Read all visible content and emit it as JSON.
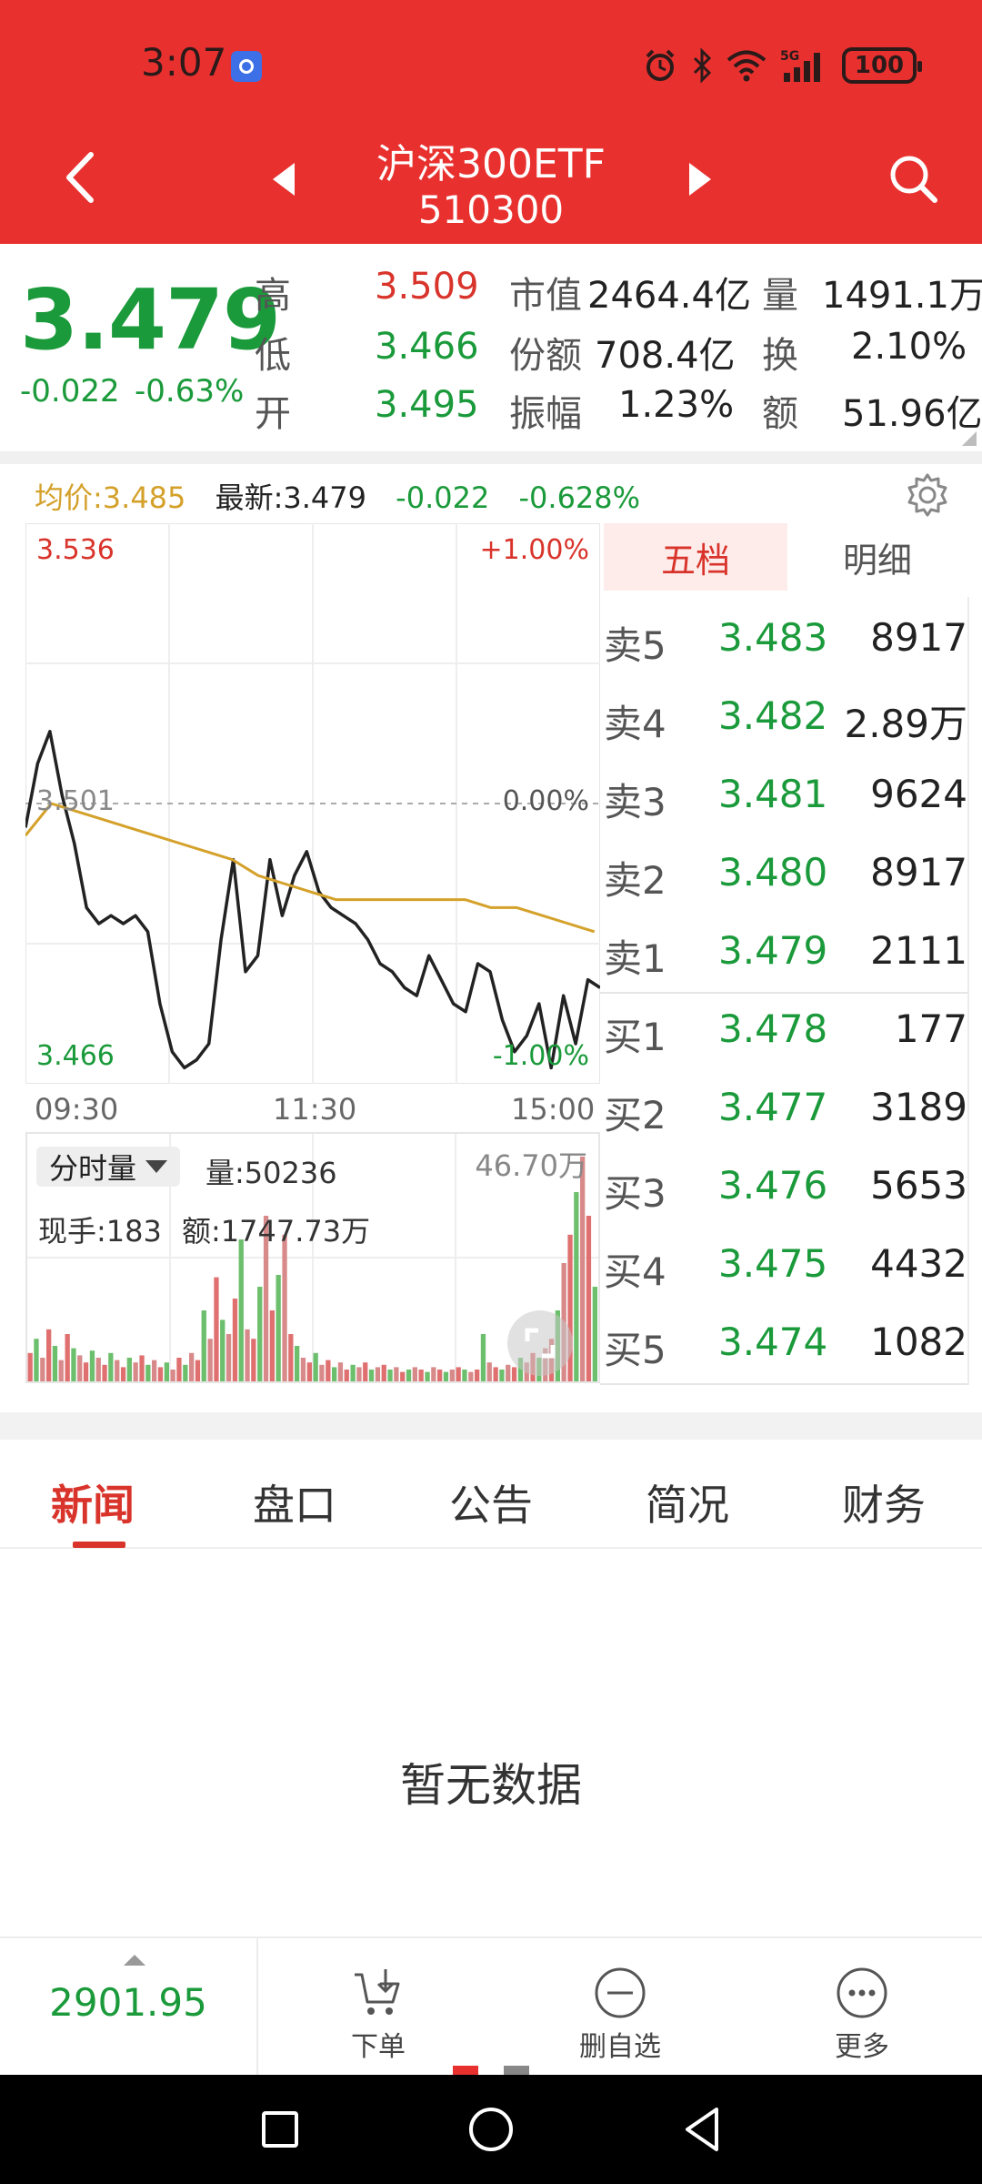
{
  "status_bar": {
    "time": "3:07",
    "battery": "100",
    "icons": [
      "alarm-icon",
      "bluetooth-icon",
      "wifi-icon",
      "signal-5g-icon",
      "battery-icon"
    ]
  },
  "header": {
    "title": "沪深300ETF",
    "code": "510300",
    "background": "#e8312f"
  },
  "quote": {
    "last_price": "3.479",
    "change": "-0.022",
    "change_pct": "-0.63%",
    "high_label": "高",
    "high": "3.509",
    "low_label": "低",
    "low": "3.466",
    "open_label": "开",
    "open": "3.495",
    "mktcap_label": "市值",
    "mktcap": "2464.4亿",
    "shares_label": "份额",
    "shares": "708.4亿",
    "amplitude_label": "振幅",
    "amplitude": "1.23%",
    "volume_label": "量",
    "volume": "1491.1万",
    "turnover_label": "换",
    "turnover": "2.10%",
    "amount_label": "额",
    "amount": "51.96亿"
  },
  "info_line": {
    "avg": "均价:3.485",
    "latest": "最新:3.479",
    "chg": "-0.022",
    "chg_pct": "-0.628%"
  },
  "chart": {
    "top_price": "3.536",
    "top_pct": "+1.00%",
    "mid_price": "3.501",
    "mid_pct": "0.00%",
    "bottom_price": "3.466",
    "bottom_pct": "-1.00%",
    "time_ticks": [
      "09:30",
      "11:30",
      "15:00"
    ]
  },
  "chart_data": {
    "type": "line",
    "title": "",
    "xlabel": "",
    "ylabel": "",
    "x": [
      "09:30",
      "11:30",
      "15:00"
    ],
    "ylim": [
      3.466,
      3.536
    ],
    "reference": 3.501,
    "series": [
      {
        "name": "",
        "color": "#222222",
        "values": [
          3.498,
          3.506,
          3.51,
          3.502,
          3.496,
          3.488,
          3.486,
          3.487,
          3.486,
          3.487,
          3.485,
          3.476,
          3.47,
          3.468,
          3.469,
          3.471,
          3.484,
          3.494,
          3.48,
          3.482,
          3.494,
          3.487,
          3.492,
          3.495,
          3.49,
          3.488,
          3.487,
          3.486,
          3.484,
          3.481,
          3.48,
          3.478,
          3.477,
          3.482,
          3.479,
          3.476,
          3.475,
          3.481,
          3.48,
          3.474,
          3.47,
          3.472,
          3.476,
          3.468,
          3.477,
          3.471,
          3.479,
          3.478
        ]
      },
      {
        "name": "",
        "color": "#d4a12a",
        "values": [
          3.497,
          3.501,
          3.5,
          3.499,
          3.498,
          3.497,
          3.496,
          3.495,
          3.494,
          3.492,
          3.491,
          3.49,
          3.489,
          3.489,
          3.489,
          3.489,
          3.489,
          3.489,
          3.488,
          3.488,
          3.487,
          3.486,
          3.485
        ]
      }
    ],
    "volume": {
      "label": "分时量",
      "current": "量:50236",
      "max": "46.70万",
      "hand": "现手:183",
      "amount": "额:1747.73万",
      "values": [
        0.12,
        0.18,
        0.1,
        0.22,
        0.15,
        0.09,
        0.2,
        0.14,
        0.11,
        0.08,
        0.13,
        0.1,
        0.07,
        0.12,
        0.09,
        0.06,
        0.1,
        0.08,
        0.11,
        0.07,
        0.09,
        0.06,
        0.08,
        0.05,
        0.1,
        0.07,
        0.12,
        0.09,
        0.3,
        0.18,
        0.44,
        0.26,
        0.2,
        0.35,
        0.6,
        0.22,
        0.18,
        0.4,
        0.7,
        0.3,
        0.45,
        0.62,
        0.2,
        0.15,
        0.1,
        0.08,
        0.12,
        0.07,
        0.09,
        0.06,
        0.08,
        0.05,
        0.07,
        0.06,
        0.08,
        0.05,
        0.06,
        0.07,
        0.05,
        0.06,
        0.04,
        0.05,
        0.06,
        0.05,
        0.04,
        0.06,
        0.05,
        0.04,
        0.05,
        0.06,
        0.05,
        0.04,
        0.05,
        0.2,
        0.08,
        0.06,
        0.05,
        0.07,
        0.06,
        0.1,
        0.08,
        0.12,
        0.1,
        0.14,
        0.18,
        0.3,
        0.5,
        0.62,
        0.8,
        0.95,
        0.7,
        0.4
      ]
    }
  },
  "order_book": {
    "tab_active": "五档",
    "tab_detail": "明细",
    "asks": [
      {
        "label": "卖5",
        "price": "3.483",
        "qty": "8917"
      },
      {
        "label": "卖4",
        "price": "3.482",
        "qty": "2.89万"
      },
      {
        "label": "卖3",
        "price": "3.481",
        "qty": "9624"
      },
      {
        "label": "卖2",
        "price": "3.480",
        "qty": "8917"
      },
      {
        "label": "卖1",
        "price": "3.479",
        "qty": "2111"
      }
    ],
    "bids": [
      {
        "label": "买1",
        "price": "3.478",
        "qty": "177"
      },
      {
        "label": "买2",
        "price": "3.477",
        "qty": "3189"
      },
      {
        "label": "买3",
        "price": "3.476",
        "qty": "5653"
      },
      {
        "label": "买4",
        "price": "3.475",
        "qty": "4432"
      },
      {
        "label": "买5",
        "price": "3.474",
        "qty": "1082"
      }
    ]
  },
  "tabs": [
    "新闻",
    "盘口",
    "公告",
    "简况",
    "财务"
  ],
  "empty_text": "暂无数据",
  "bottom_bar": {
    "index_value": "2901.95",
    "order_label": "下单",
    "remove_watch_label": "删自选",
    "more_label": "更多"
  },
  "colors": {
    "red": "#d9342b",
    "green": "#1a9a3a",
    "avg_line": "#d4a12a",
    "header": "#e8312f"
  }
}
